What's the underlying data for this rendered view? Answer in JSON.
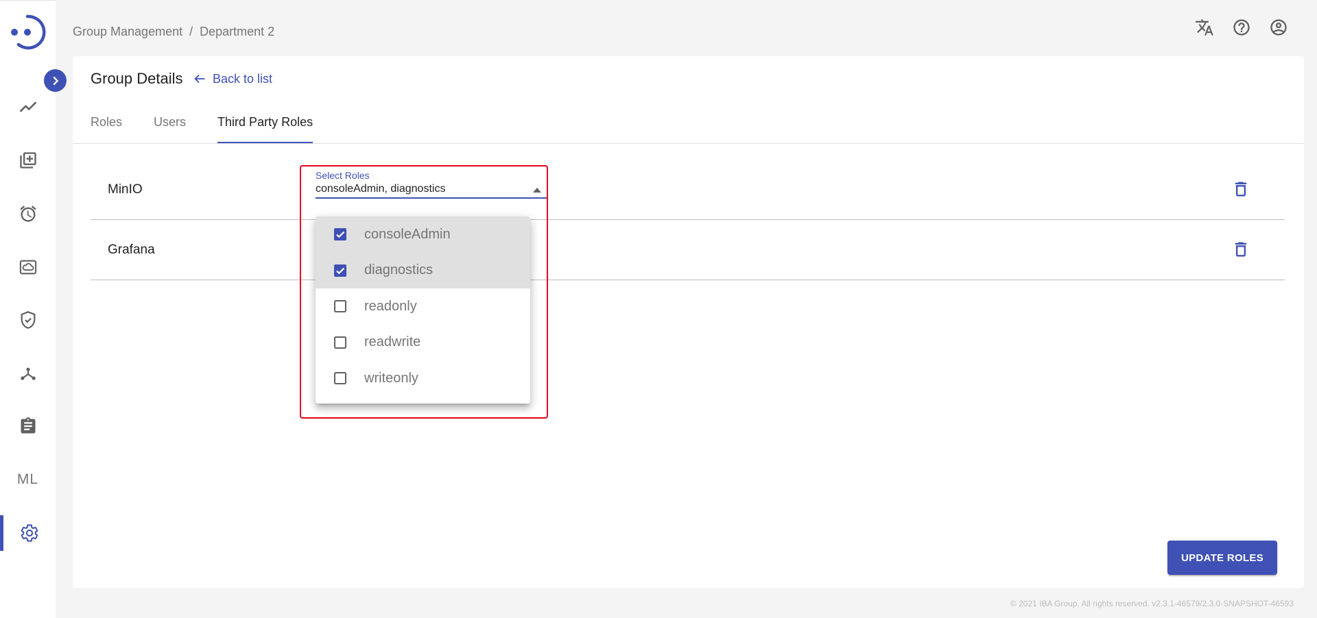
{
  "breadcrumb": {
    "items": [
      "Group Management",
      "Department 2"
    ],
    "separator": "/"
  },
  "header": {
    "icons": [
      "translate-icon",
      "help-icon",
      "account-icon"
    ]
  },
  "sidebar": {
    "items": [
      {
        "name": "analytics",
        "icon": "trending-line-icon"
      },
      {
        "name": "library",
        "icon": "library-add-icon"
      },
      {
        "name": "alarm",
        "icon": "alarm-icon"
      },
      {
        "name": "cloud",
        "icon": "cloud-storage-icon"
      },
      {
        "name": "security",
        "icon": "shield-check-icon"
      },
      {
        "name": "network",
        "icon": "hub-icon"
      },
      {
        "name": "assignment",
        "icon": "clipboard-icon"
      },
      {
        "name": "ml",
        "label": "ML"
      },
      {
        "name": "settings",
        "icon": "gear-icon",
        "active": true
      }
    ]
  },
  "card": {
    "title": "Group Details",
    "back_label": "Back to list",
    "tabs": [
      {
        "label": "Roles",
        "active": false
      },
      {
        "label": "Users",
        "active": false
      },
      {
        "label": "Third Party Roles",
        "active": true
      }
    ],
    "rows": [
      {
        "label": "MinIO"
      },
      {
        "label": "Grafana"
      }
    ],
    "select": {
      "label": "Select Roles",
      "value": "consoleAdmin, diagnostics"
    },
    "dropdown_options": [
      {
        "label": "consoleAdmin",
        "checked": true
      },
      {
        "label": "diagnostics",
        "checked": true
      },
      {
        "label": "readonly",
        "checked": false
      },
      {
        "label": "readwrite",
        "checked": false
      },
      {
        "label": "writeonly",
        "checked": false
      }
    ],
    "update_button": "UPDATE ROLES"
  },
  "footer": {
    "text": "© 2021 IBA Group. All rights reserved. v2.3.1-46579/2.3.0-SNAPSHOT-46593"
  },
  "colors": {
    "accent": "#3f51b5",
    "highlight": "#e5001a"
  }
}
